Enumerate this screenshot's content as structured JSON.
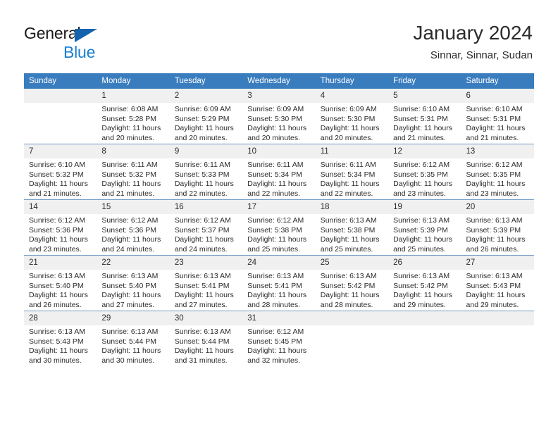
{
  "brand": {
    "name_part1": "General",
    "name_part2": "Blue"
  },
  "header": {
    "title": "January 2024",
    "subtitle": "Sinnar, Sinnar, Sudan"
  },
  "calendar": {
    "weekday_headers": [
      "Sunday",
      "Monday",
      "Tuesday",
      "Wednesday",
      "Thursday",
      "Friday",
      "Saturday"
    ],
    "colors": {
      "header_background": "#3a7dbf",
      "header_text": "#ffffff",
      "daynum_background": "#f0f0f0",
      "row_separator": "#6f9cc6",
      "brand_blue": "#1a7ed1",
      "brand_triangle": "#1464ad"
    },
    "weeks": [
      [
        {
          "day": "",
          "sunrise": "",
          "sunset": "",
          "daylight_line1": "",
          "daylight_line2": ""
        },
        {
          "day": "1",
          "sunrise": "Sunrise: 6:08 AM",
          "sunset": "Sunset: 5:28 PM",
          "daylight_line1": "Daylight: 11 hours",
          "daylight_line2": "and 20 minutes."
        },
        {
          "day": "2",
          "sunrise": "Sunrise: 6:09 AM",
          "sunset": "Sunset: 5:29 PM",
          "daylight_line1": "Daylight: 11 hours",
          "daylight_line2": "and 20 minutes."
        },
        {
          "day": "3",
          "sunrise": "Sunrise: 6:09 AM",
          "sunset": "Sunset: 5:30 PM",
          "daylight_line1": "Daylight: 11 hours",
          "daylight_line2": "and 20 minutes."
        },
        {
          "day": "4",
          "sunrise": "Sunrise: 6:09 AM",
          "sunset": "Sunset: 5:30 PM",
          "daylight_line1": "Daylight: 11 hours",
          "daylight_line2": "and 20 minutes."
        },
        {
          "day": "5",
          "sunrise": "Sunrise: 6:10 AM",
          "sunset": "Sunset: 5:31 PM",
          "daylight_line1": "Daylight: 11 hours",
          "daylight_line2": "and 21 minutes."
        },
        {
          "day": "6",
          "sunrise": "Sunrise: 6:10 AM",
          "sunset": "Sunset: 5:31 PM",
          "daylight_line1": "Daylight: 11 hours",
          "daylight_line2": "and 21 minutes."
        }
      ],
      [
        {
          "day": "7",
          "sunrise": "Sunrise: 6:10 AM",
          "sunset": "Sunset: 5:32 PM",
          "daylight_line1": "Daylight: 11 hours",
          "daylight_line2": "and 21 minutes."
        },
        {
          "day": "8",
          "sunrise": "Sunrise: 6:11 AM",
          "sunset": "Sunset: 5:32 PM",
          "daylight_line1": "Daylight: 11 hours",
          "daylight_line2": "and 21 minutes."
        },
        {
          "day": "9",
          "sunrise": "Sunrise: 6:11 AM",
          "sunset": "Sunset: 5:33 PM",
          "daylight_line1": "Daylight: 11 hours",
          "daylight_line2": "and 22 minutes."
        },
        {
          "day": "10",
          "sunrise": "Sunrise: 6:11 AM",
          "sunset": "Sunset: 5:34 PM",
          "daylight_line1": "Daylight: 11 hours",
          "daylight_line2": "and 22 minutes."
        },
        {
          "day": "11",
          "sunrise": "Sunrise: 6:11 AM",
          "sunset": "Sunset: 5:34 PM",
          "daylight_line1": "Daylight: 11 hours",
          "daylight_line2": "and 22 minutes."
        },
        {
          "day": "12",
          "sunrise": "Sunrise: 6:12 AM",
          "sunset": "Sunset: 5:35 PM",
          "daylight_line1": "Daylight: 11 hours",
          "daylight_line2": "and 23 minutes."
        },
        {
          "day": "13",
          "sunrise": "Sunrise: 6:12 AM",
          "sunset": "Sunset: 5:35 PM",
          "daylight_line1": "Daylight: 11 hours",
          "daylight_line2": "and 23 minutes."
        }
      ],
      [
        {
          "day": "14",
          "sunrise": "Sunrise: 6:12 AM",
          "sunset": "Sunset: 5:36 PM",
          "daylight_line1": "Daylight: 11 hours",
          "daylight_line2": "and 23 minutes."
        },
        {
          "day": "15",
          "sunrise": "Sunrise: 6:12 AM",
          "sunset": "Sunset: 5:36 PM",
          "daylight_line1": "Daylight: 11 hours",
          "daylight_line2": "and 24 minutes."
        },
        {
          "day": "16",
          "sunrise": "Sunrise: 6:12 AM",
          "sunset": "Sunset: 5:37 PM",
          "daylight_line1": "Daylight: 11 hours",
          "daylight_line2": "and 24 minutes."
        },
        {
          "day": "17",
          "sunrise": "Sunrise: 6:12 AM",
          "sunset": "Sunset: 5:38 PM",
          "daylight_line1": "Daylight: 11 hours",
          "daylight_line2": "and 25 minutes."
        },
        {
          "day": "18",
          "sunrise": "Sunrise: 6:13 AM",
          "sunset": "Sunset: 5:38 PM",
          "daylight_line1": "Daylight: 11 hours",
          "daylight_line2": "and 25 minutes."
        },
        {
          "day": "19",
          "sunrise": "Sunrise: 6:13 AM",
          "sunset": "Sunset: 5:39 PM",
          "daylight_line1": "Daylight: 11 hours",
          "daylight_line2": "and 25 minutes."
        },
        {
          "day": "20",
          "sunrise": "Sunrise: 6:13 AM",
          "sunset": "Sunset: 5:39 PM",
          "daylight_line1": "Daylight: 11 hours",
          "daylight_line2": "and 26 minutes."
        }
      ],
      [
        {
          "day": "21",
          "sunrise": "Sunrise: 6:13 AM",
          "sunset": "Sunset: 5:40 PM",
          "daylight_line1": "Daylight: 11 hours",
          "daylight_line2": "and 26 minutes."
        },
        {
          "day": "22",
          "sunrise": "Sunrise: 6:13 AM",
          "sunset": "Sunset: 5:40 PM",
          "daylight_line1": "Daylight: 11 hours",
          "daylight_line2": "and 27 minutes."
        },
        {
          "day": "23",
          "sunrise": "Sunrise: 6:13 AM",
          "sunset": "Sunset: 5:41 PM",
          "daylight_line1": "Daylight: 11 hours",
          "daylight_line2": "and 27 minutes."
        },
        {
          "day": "24",
          "sunrise": "Sunrise: 6:13 AM",
          "sunset": "Sunset: 5:41 PM",
          "daylight_line1": "Daylight: 11 hours",
          "daylight_line2": "and 28 minutes."
        },
        {
          "day": "25",
          "sunrise": "Sunrise: 6:13 AM",
          "sunset": "Sunset: 5:42 PM",
          "daylight_line1": "Daylight: 11 hours",
          "daylight_line2": "and 28 minutes."
        },
        {
          "day": "26",
          "sunrise": "Sunrise: 6:13 AM",
          "sunset": "Sunset: 5:42 PM",
          "daylight_line1": "Daylight: 11 hours",
          "daylight_line2": "and 29 minutes."
        },
        {
          "day": "27",
          "sunrise": "Sunrise: 6:13 AM",
          "sunset": "Sunset: 5:43 PM",
          "daylight_line1": "Daylight: 11 hours",
          "daylight_line2": "and 29 minutes."
        }
      ],
      [
        {
          "day": "28",
          "sunrise": "Sunrise: 6:13 AM",
          "sunset": "Sunset: 5:43 PM",
          "daylight_line1": "Daylight: 11 hours",
          "daylight_line2": "and 30 minutes."
        },
        {
          "day": "29",
          "sunrise": "Sunrise: 6:13 AM",
          "sunset": "Sunset: 5:44 PM",
          "daylight_line1": "Daylight: 11 hours",
          "daylight_line2": "and 30 minutes."
        },
        {
          "day": "30",
          "sunrise": "Sunrise: 6:13 AM",
          "sunset": "Sunset: 5:44 PM",
          "daylight_line1": "Daylight: 11 hours",
          "daylight_line2": "and 31 minutes."
        },
        {
          "day": "31",
          "sunrise": "Sunrise: 6:12 AM",
          "sunset": "Sunset: 5:45 PM",
          "daylight_line1": "Daylight: 11 hours",
          "daylight_line2": "and 32 minutes."
        },
        {
          "day": "",
          "sunrise": "",
          "sunset": "",
          "daylight_line1": "",
          "daylight_line2": ""
        },
        {
          "day": "",
          "sunrise": "",
          "sunset": "",
          "daylight_line1": "",
          "daylight_line2": ""
        },
        {
          "day": "",
          "sunrise": "",
          "sunset": "",
          "daylight_line1": "",
          "daylight_line2": ""
        }
      ]
    ]
  }
}
